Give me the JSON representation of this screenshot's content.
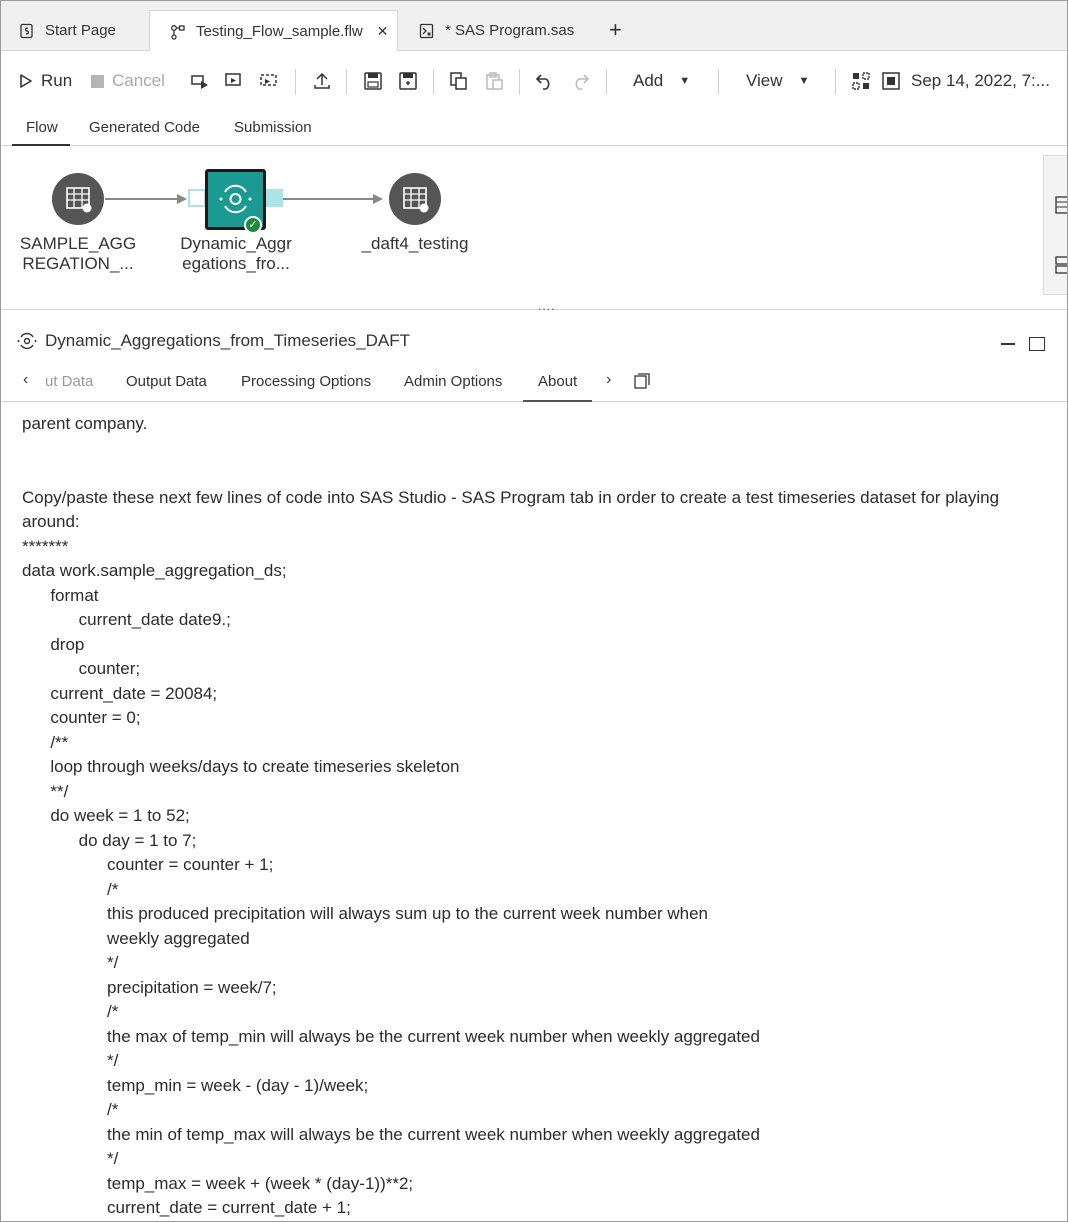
{
  "doc_tabs": {
    "start_page": "Start Page",
    "flow_file": "Testing_Flow_sample.flw",
    "sas_program": "* SAS Program.sas"
  },
  "toolbar": {
    "run": "Run",
    "cancel": "Cancel",
    "add": "Add",
    "view": "View",
    "timestamp": "Sep 14, 2022, 7:..."
  },
  "view_tabs": [
    "Flow",
    "Generated Code",
    "Submission"
  ],
  "flow": {
    "nodes": [
      {
        "label_line1": "SAMPLE_AGG",
        "label_line2": "REGATION_..."
      },
      {
        "label_line1": "Dynamic_Aggr",
        "label_line2": "egations_fro..."
      },
      {
        "label_line1": "_daft4_testing",
        "label_line2": ""
      }
    ],
    "grip": "...."
  },
  "panel": {
    "title": "Dynamic_Aggregations_from_Timeseries_DAFT",
    "tabs": {
      "input_partial": "ut Data",
      "output": "Output Data",
      "processing": "Processing Options",
      "admin": "Admin Options",
      "about": "About"
    }
  },
  "about": {
    "intro": "parent company.",
    "blank": "",
    "copy_note": "Copy/paste these next few lines of code into SAS Studio - SAS Program tab in order to create a test timeseries dataset for playing around:",
    "code_lines": [
      "*******",
      "data work.sample_aggregation_ds;",
      "      format",
      "            current_date date9.;",
      "      drop",
      "            counter;",
      "      current_date = 20084;",
      "      counter = 0;",
      "      /**",
      "      loop through weeks/days to create timeseries skeleton",
      "      **/",
      "      do week = 1 to 52;",
      "            do day = 1 to 7;",
      "                  counter = counter + 1;",
      "                  /*",
      "                  this produced precipitation will always sum up to the current week number when",
      "                  weekly aggregated",
      "                  */",
      "                  precipitation = week/7;",
      "                  /*",
      "                  the max of temp_min will always be the current week number when weekly aggregated",
      "                  */",
      "                  temp_min = week - (day - 1)/week;",
      "                  /*",
      "                  the min of temp_max will always be the current week number when weekly aggregated",
      "                  */",
      "                  temp_max = week + (week * (day-1))**2;",
      "                  current_date = current_date + 1;"
    ]
  },
  "colors": {
    "node_gray": "#555555",
    "node_teal": "#1b9a93",
    "port_teal": "#a8e6e6",
    "success_green": "#1f8a3a"
  }
}
